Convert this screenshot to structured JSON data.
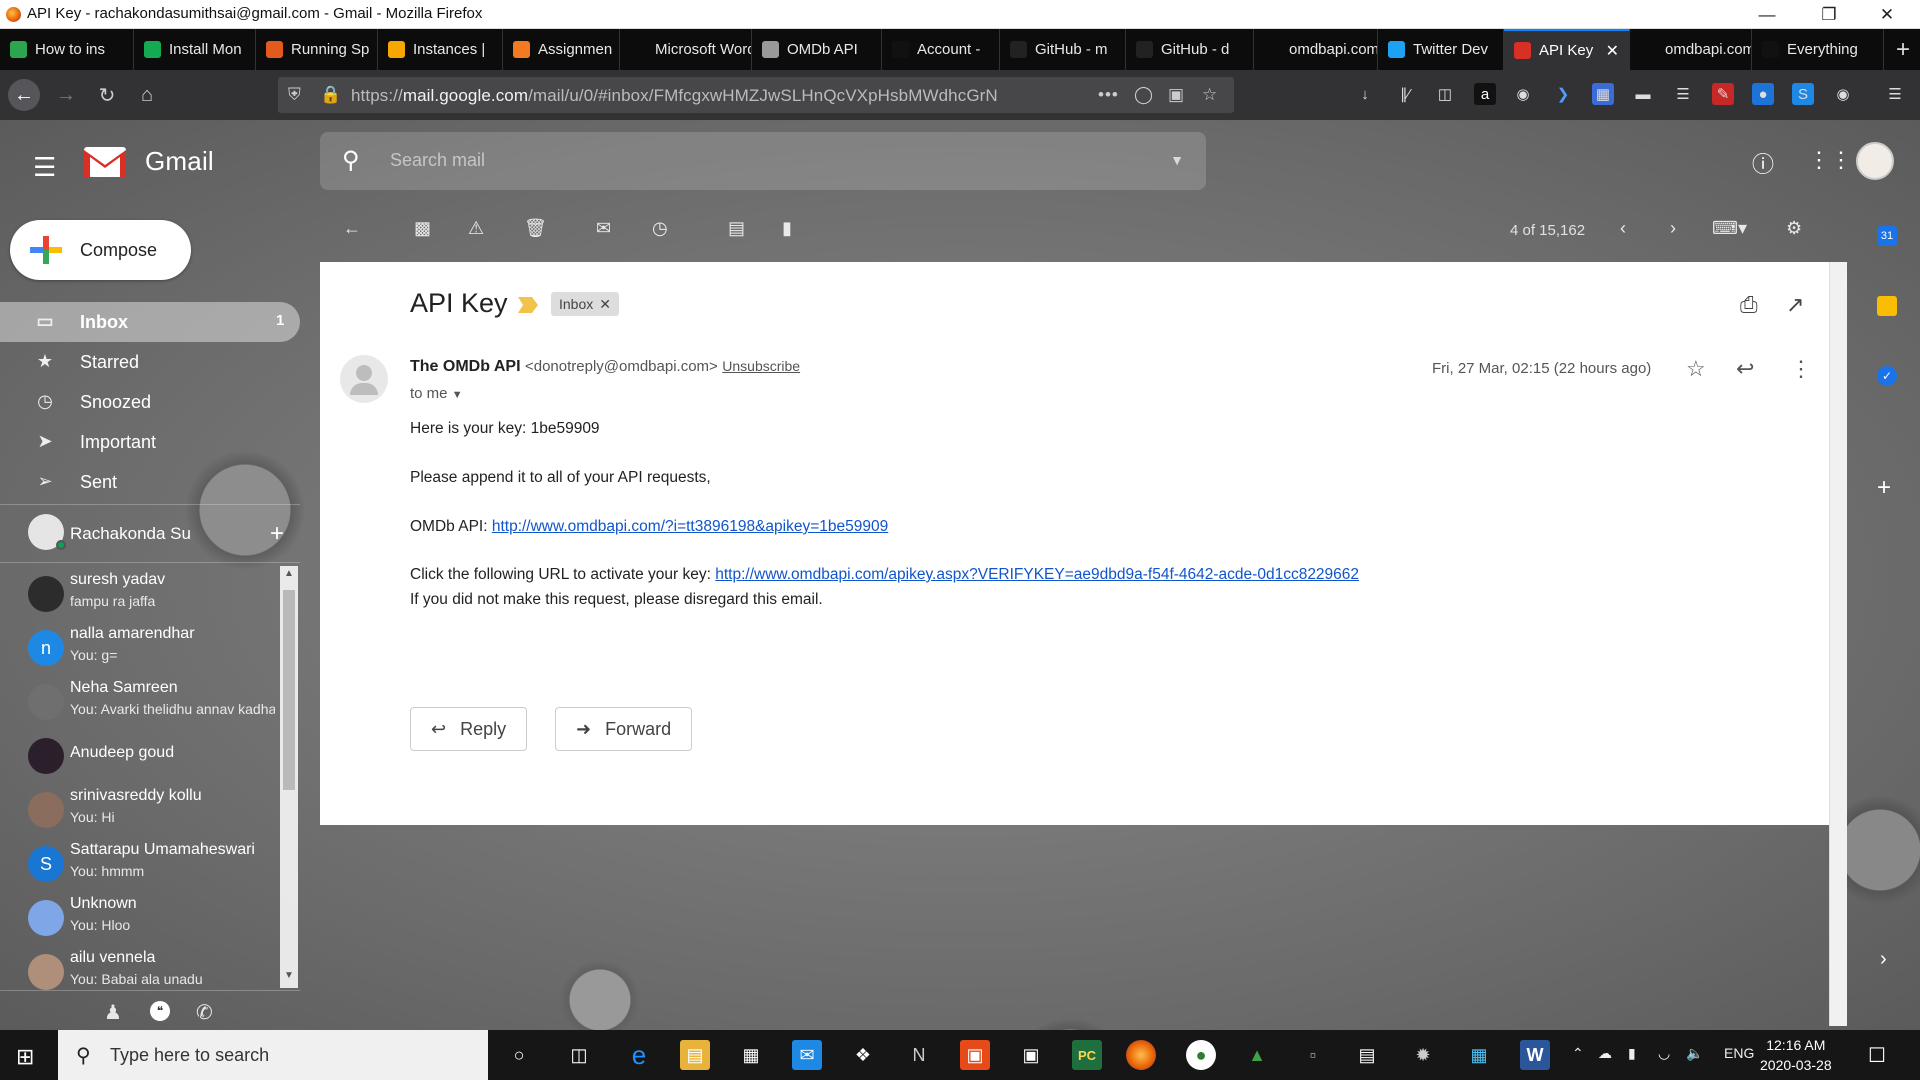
{
  "window": {
    "title": "API Key - rachakondasumithsai@gmail.com - Gmail - Mozilla Firefox"
  },
  "tabs": [
    {
      "label": "How to ins",
      "icon_color": "#2da44e"
    },
    {
      "label": "Install Mon",
      "icon_color": "#13aa52"
    },
    {
      "label": "Running Sp",
      "icon_color": "#e25a1c"
    },
    {
      "label": "Instances |",
      "icon_color": "#f7a800"
    },
    {
      "label": "Assignmen",
      "icon_color": "#f27b21"
    },
    {
      "label": "Microsoft Word",
      "icon_color": "#0c0c0d"
    },
    {
      "label": "OMDb API",
      "icon_color": "#999999"
    },
    {
      "label": "Account - ",
      "icon_color": "#111111"
    },
    {
      "label": "GitHub - m",
      "icon_color": "#222222"
    },
    {
      "label": "GitHub - d",
      "icon_color": "#222222"
    },
    {
      "label": "omdbapi.com/",
      "icon_color": "#0c0c0d"
    },
    {
      "label": "Twitter Dev",
      "icon_color": "#1da1f2"
    },
    {
      "label": "API Key",
      "icon_color": "#d93025"
    },
    {
      "label": "omdbapi.com/",
      "icon_color": "#0c0c0d"
    },
    {
      "label": "Everything",
      "icon_color": "#111111"
    }
  ],
  "address": {
    "prefix": "https://",
    "domain": "mail.google.com",
    "path": "/mail/u/0/#inbox/FMfcgxwHMZJwSLHnQcVXpHsbMWdhcGrN"
  },
  "gmail": {
    "brand": "Gmail",
    "search_placeholder": "Search mail",
    "compose_label": "Compose",
    "page_count": "4 of 15,162",
    "nav": [
      {
        "label": "Inbox",
        "count": "1",
        "icon": "inbox-icon",
        "glyph": "▭"
      },
      {
        "label": "Starred",
        "count": "",
        "icon": "star-icon",
        "glyph": "★"
      },
      {
        "label": "Snoozed",
        "count": "",
        "icon": "clock-icon",
        "glyph": "◷"
      },
      {
        "label": "Important",
        "count": "",
        "icon": "important-icon",
        "glyph": "➤"
      },
      {
        "label": "Sent",
        "count": "",
        "icon": "send-icon",
        "glyph": "➢"
      }
    ],
    "hangouts_user": "Rachakonda Su",
    "contacts": [
      {
        "name": "suresh yadav",
        "msg": "fampu ra jaffa",
        "avatar_color": "#2c2c2c",
        "initial": ""
      },
      {
        "name": "nalla amarendhar",
        "msg": "You: g=",
        "avatar_color": "#1e88e5",
        "initial": "n"
      },
      {
        "name": "Neha Samreen",
        "msg": "You: Avarki thelidhu annav kadha",
        "avatar_color": "#6f6f6f",
        "initial": ""
      },
      {
        "name": "Anudeep goud",
        "msg": "",
        "avatar_color": "#2a1f2a",
        "initial": ""
      },
      {
        "name": "srinivasreddy kollu",
        "msg": "You: Hi",
        "avatar_color": "#8a6d5d",
        "initial": ""
      },
      {
        "name": "Sattarapu Umamaheswari",
        "msg": "You: hmmm",
        "avatar_color": "#1976d2",
        "initial": "S"
      },
      {
        "name": "Unknown",
        "msg": "You: Hloo",
        "avatar_color": "#7fa7e8",
        "initial": ""
      },
      {
        "name": "ailu vennela",
        "msg": "You: Babai ala unadu",
        "avatar_color": "#b08f7a",
        "initial": ""
      }
    ]
  },
  "message": {
    "subject": "API Key",
    "label": "Inbox",
    "sender_name": "The OMDb API",
    "sender_email": "<donotreply@omdbapi.com>",
    "unsubscribe": "Unsubscribe",
    "to": "to me",
    "date": "Fri, 27 Mar, 02:15 (22 hours ago)",
    "line1": "Here is your key: 1be59909",
    "line2": "Please append it to all of your API requests,",
    "line3_prefix": "OMDb API: ",
    "line3_link": "http://www.omdbapi.com/?i=tt3896198&apikey=1be59909",
    "line4_prefix": "Click the following URL to activate your key: ",
    "line4_link": "http://www.omdbapi.com/apikey.aspx?VERIFYKEY=ae9dbd9a-f54f-4642-acde-0d1cc8229662",
    "line5": "If you did not make this request, please disregard this email.",
    "reply_label": "Reply",
    "forward_label": "Forward"
  },
  "taskbar": {
    "search_placeholder": "Type here to search",
    "language": "ENG",
    "time": "12:16 AM",
    "date": "2020-03-28"
  },
  "colors": {
    "accent": "#0a84ff",
    "gmail_red": "#d93025",
    "link": "#1155cc"
  }
}
